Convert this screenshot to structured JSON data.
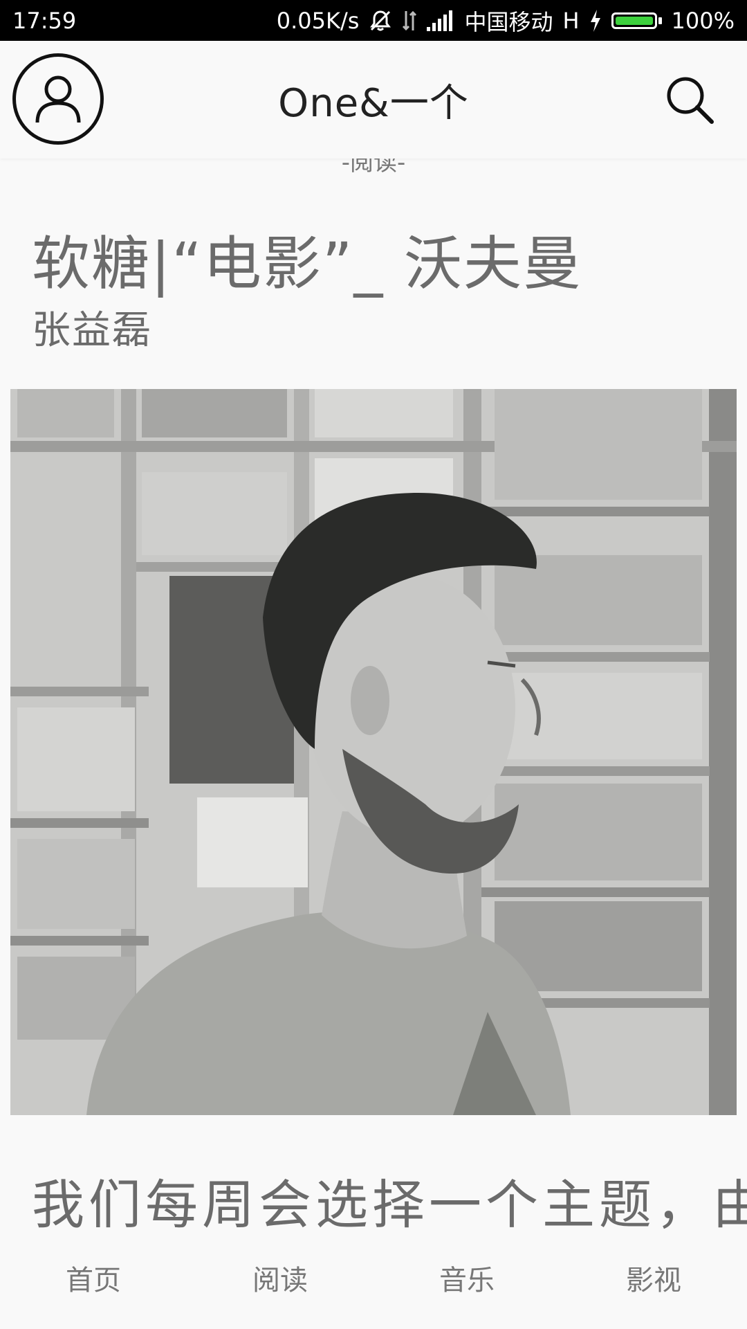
{
  "status_bar": {
    "time": "17:59",
    "net_speed": "0.05K/s",
    "carrier": "中国移动",
    "network_type": "H",
    "battery_percent": "100%",
    "battery_level": 1.0,
    "battery_color": "#3dd13d"
  },
  "header": {
    "title": "One&一个"
  },
  "article": {
    "section_label": "-阅读-",
    "title": "软糖|“电影”_ 沃夫曼",
    "author": "张益磊",
    "body_first_line": "我们每周会选择一个主题，由"
  },
  "bottom_nav": {
    "items": [
      {
        "label": "首页"
      },
      {
        "label": "阅读"
      },
      {
        "label": "音乐"
      },
      {
        "label": "影视"
      }
    ]
  }
}
